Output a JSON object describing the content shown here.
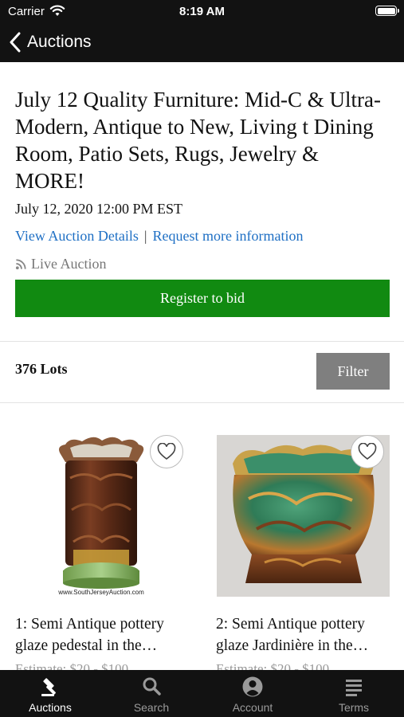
{
  "status_bar": {
    "carrier": "Carrier",
    "time": "8:19 AM"
  },
  "nav": {
    "back_label": "Auctions"
  },
  "auction": {
    "title": "July 12 Quality Furniture: Mid-C & Ultra-Modern, Antique to New, Living t Dining Room, Patio Sets, Rugs, Jewelry & MORE!",
    "date": "July 12, 2020 12:00 PM EST",
    "details_link": "View Auction Details",
    "separator": "|",
    "info_link": "Request more information",
    "type": "Live Auction",
    "register_label": "Register to bid"
  },
  "lots": {
    "count_label": "376 Lots",
    "filter_label": "Filter",
    "items": [
      {
        "title": "1: Semi Antique pottery glaze pedestal in the…",
        "estimate": "Estimate: $20 - $100",
        "image_caption": "www.SouthJerseyAuction.com"
      },
      {
        "title": "2: Semi Antique pottery glaze Jardinière in the…",
        "estimate": "Estimate: $20 - $100"
      }
    ]
  },
  "tabs": [
    {
      "label": "Auctions",
      "icon": "gavel-icon",
      "active": true
    },
    {
      "label": "Search",
      "icon": "search-icon",
      "active": false
    },
    {
      "label": "Account",
      "icon": "account-icon",
      "active": false
    },
    {
      "label": "Terms",
      "icon": "terms-icon",
      "active": false
    }
  ],
  "colors": {
    "accent_green": "#118a11",
    "link_blue": "#1e6fc4",
    "filter_gray": "#7f7f7f",
    "bar_black": "#121212",
    "tab_active": "#ffffff",
    "tab_inactive": "#9a9a9a"
  }
}
